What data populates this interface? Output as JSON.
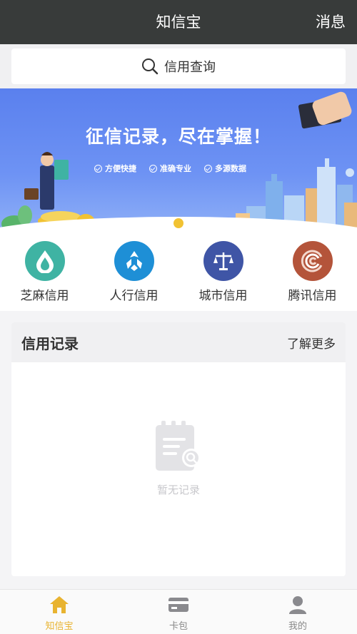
{
  "header": {
    "title": "知信宝",
    "message_label": "消息"
  },
  "search": {
    "label": "信用查询"
  },
  "banner": {
    "headline": "征信记录，尽在掌握！",
    "features": [
      "方便快捷",
      "准确专业",
      "多源数据"
    ]
  },
  "shortcuts": [
    {
      "label": "芝麻信用",
      "color": "#3fb3a3",
      "icon": "sesame-drop-icon"
    },
    {
      "label": "人行信用",
      "color": "#1e8fd6",
      "icon": "bank-emblem-icon"
    },
    {
      "label": "城市信用",
      "color": "#3f55a6",
      "icon": "scales-icon"
    },
    {
      "label": "腾讯信用",
      "color": "#b4543a",
      "icon": "tencent-credit-icon"
    }
  ],
  "records": {
    "title": "信用记录",
    "more_label": "了解更多",
    "empty_text": "暂无记录"
  },
  "tabbar": {
    "items": [
      {
        "label": "知信宝",
        "icon": "home-icon",
        "active": true
      },
      {
        "label": "卡包",
        "icon": "card-icon",
        "active": false
      },
      {
        "label": "我的",
        "icon": "user-icon",
        "active": false
      }
    ],
    "active_color": "#e8b330"
  }
}
